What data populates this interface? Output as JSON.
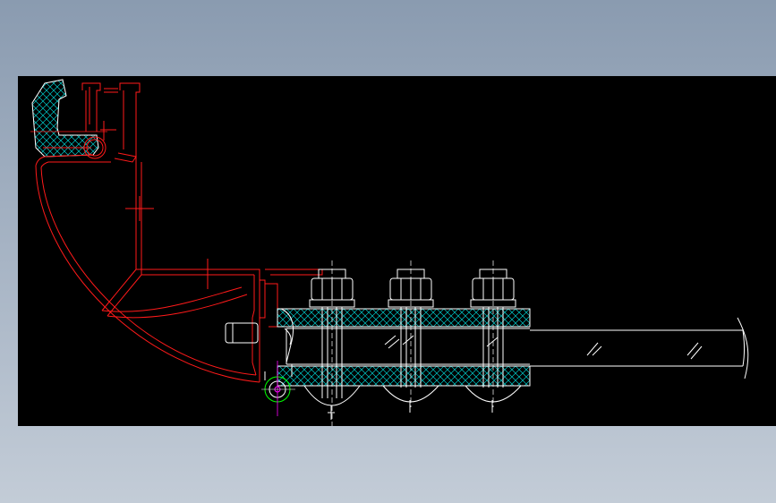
{
  "drawing": {
    "background": "#000000",
    "page_background": "#9aa9bc",
    "colors": {
      "profile": "#ff1a1a",
      "bolts": "#ffffff",
      "hatch": "#00c8c8",
      "center": "#ff00ff",
      "pivot": "#00ff00"
    },
    "bolt_count": 3,
    "glass_hatch_count": 4
  }
}
